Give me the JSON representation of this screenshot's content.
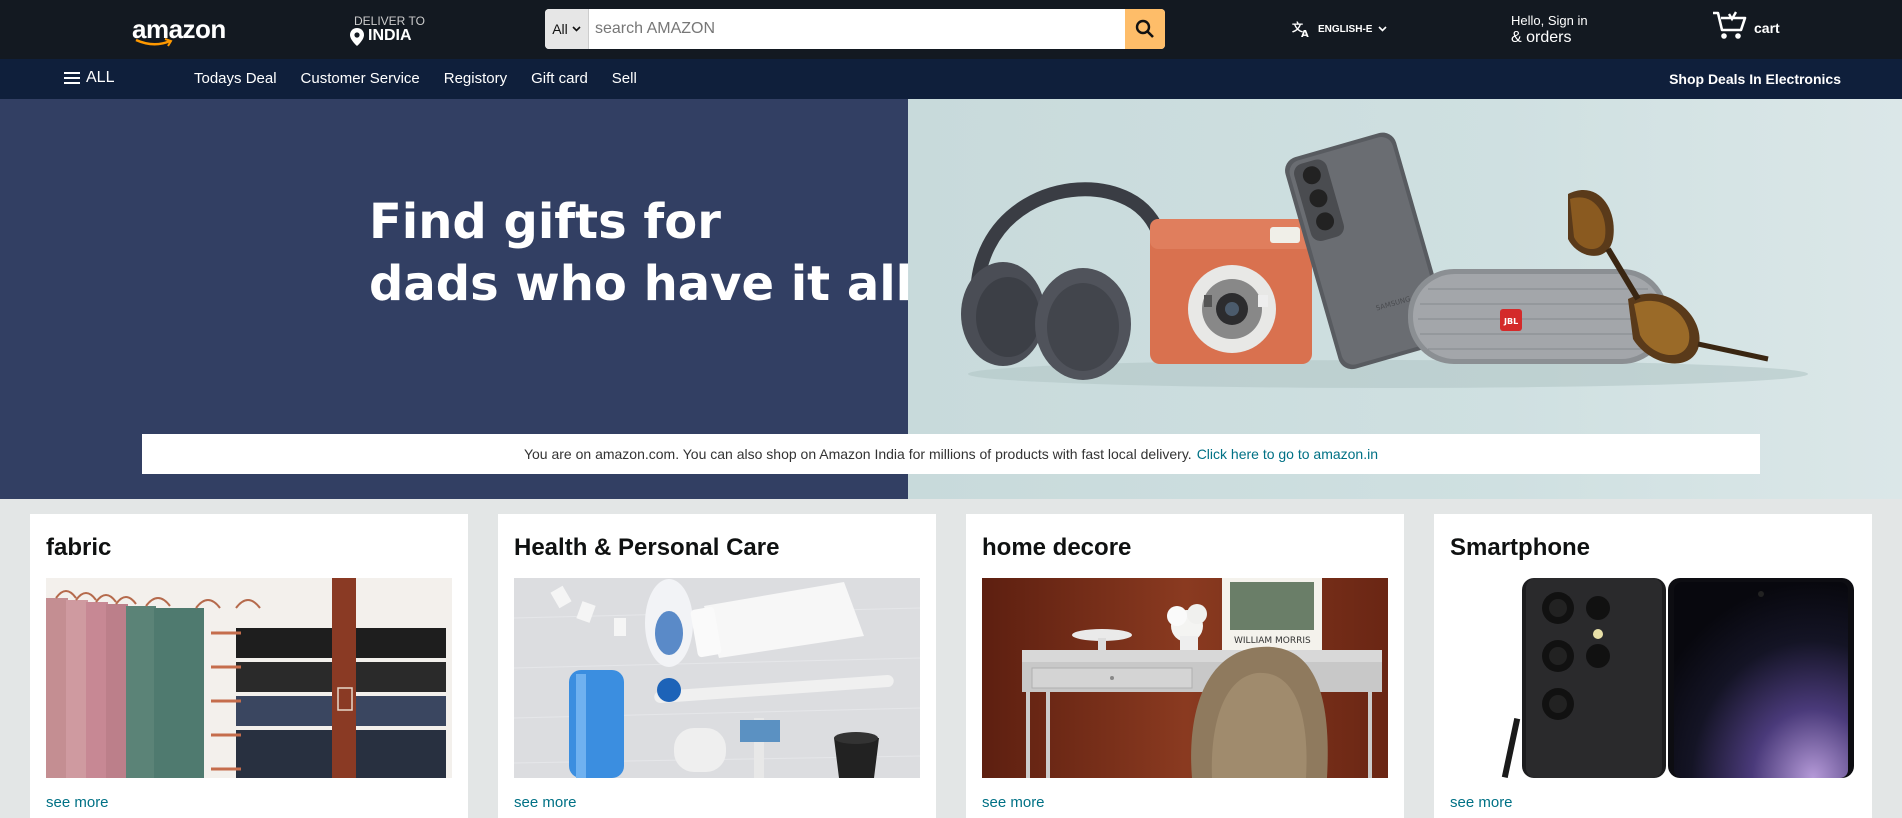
{
  "header": {
    "logo_text": "amazon",
    "deliver_small": "DELIVER TO",
    "deliver_big": "INDIA",
    "search_category": "All",
    "search_placeholder": "search AMAZON",
    "language": "ENGLISH-E",
    "account_line1": "Hello, Sign in",
    "account_line2": "& orders",
    "cart_label": "cart",
    "accent_color": "#febd69",
    "bg_color": "#131921"
  },
  "nav": {
    "all_label": "ALL",
    "links": [
      "Todays Deal",
      "Customer Service",
      "Registory",
      "Gift card",
      "Sell"
    ],
    "promo": "Shop Deals In Electronics",
    "bg_color": "#0f1f3b"
  },
  "hero": {
    "title": "Find gifts for\ndads who have it all",
    "notice_text": "You are on amazon.com. You can also shop on Amazon India for millions of products with fast local delivery.",
    "notice_link": "Click here to go to amazon.in",
    "left_color": "#323f63"
  },
  "cards": [
    {
      "title": "fabric",
      "link": "see more",
      "image": "fabric-hangers-image"
    },
    {
      "title": "Health & Personal Care",
      "link": "see more",
      "image": "personal-care-products-image"
    },
    {
      "title": "home decore",
      "link": "see more",
      "image": "desk-decor-image"
    },
    {
      "title": "Smartphone",
      "link": "see more",
      "image": "smartphone-image"
    }
  ]
}
